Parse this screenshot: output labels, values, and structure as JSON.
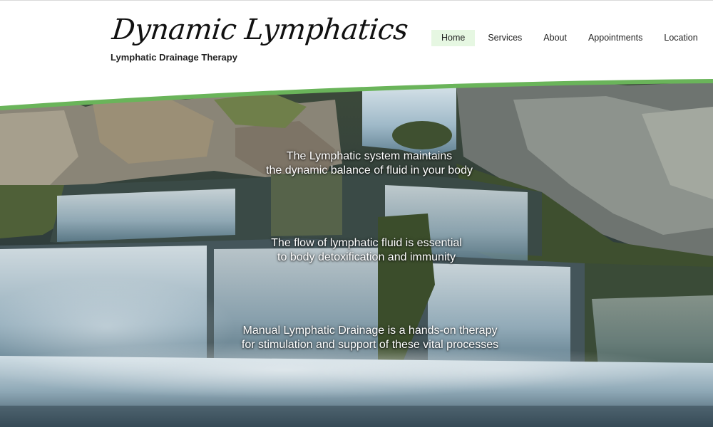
{
  "header": {
    "logo_text": "Dynamic Lymphatics",
    "tagline": "Lymphatic Drainage Therapy"
  },
  "nav": {
    "items": [
      {
        "label": "Home"
      },
      {
        "label": "Services"
      },
      {
        "label": "About"
      },
      {
        "label": "Appointments"
      },
      {
        "label": "Location"
      }
    ],
    "active": "Home"
  },
  "hero": {
    "captions": [
      {
        "line1": "The Lymphatic system maintains",
        "line2": "the dynamic balance of fluid in your body"
      },
      {
        "line1": "The flow of lymphatic fluid is essential",
        "line2": "to body detoxification and immunity"
      },
      {
        "line1": "Manual Lymphatic Drainage is a hands-on therapy",
        "line2": "for stimulation and support of these vital processes"
      }
    ]
  },
  "colors": {
    "accent_green": "#6ab45a",
    "active_nav_bg": "#e6f7e2",
    "water": "#9fb9c8",
    "rock": "#5d6a4a"
  }
}
